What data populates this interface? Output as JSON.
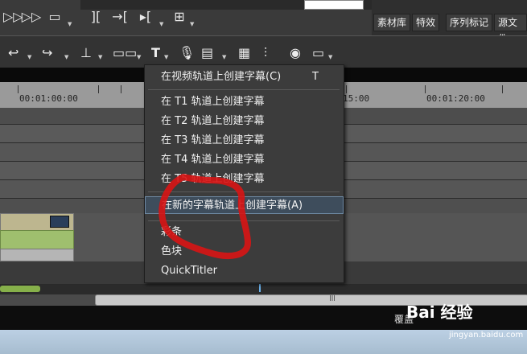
{
  "top_toolbar": {
    "buttons": [
      "play-reverse-icon",
      "fast-forward-icon",
      "subtitle-icon",
      "mark-in-icon",
      "mark-out-icon",
      "split-icon",
      "match-frame-icon"
    ]
  },
  "right_panel": {
    "tabs": [
      "素材库",
      "特效",
      "序列标记",
      "源文件"
    ]
  },
  "toolbar2": {
    "buttons": [
      "undo-icon",
      "redo-icon",
      "ripple-icon",
      "link-icon",
      "title-icon",
      "microphone-icon",
      "mixer-icon",
      "grid-icon",
      "audio-mixer-icon",
      "color-icon",
      "window-icon"
    ]
  },
  "timeline": {
    "ruler_labels": [
      "00:01:00:00",
      "15:00",
      "00:01:20:00"
    ]
  },
  "context_menu": {
    "items": [
      {
        "label": "在视频轨道上创建字幕(C)",
        "shortcut": "T"
      },
      {
        "label": "在 T1 轨道上创建字幕"
      },
      {
        "label": "在 T2 轨道上创建字幕"
      },
      {
        "label": "在 T3 轨道上创建字幕"
      },
      {
        "label": "在 T4 轨道上创建字幕"
      },
      {
        "label": "在 T5 轨道上创建字幕"
      },
      {
        "label": "在新的字幕轨道上创建字幕(A)"
      },
      {
        "label": "彩条"
      },
      {
        "label": "色块"
      },
      {
        "label": "QuickTitler"
      }
    ]
  },
  "status": {
    "text": "覆盖"
  },
  "watermark": {
    "brand": "Bai 经验",
    "url": "jingyan.baidu.com"
  },
  "colors": {
    "annotation_red": "#d81414",
    "menu_highlight": "#3e4d5c"
  }
}
